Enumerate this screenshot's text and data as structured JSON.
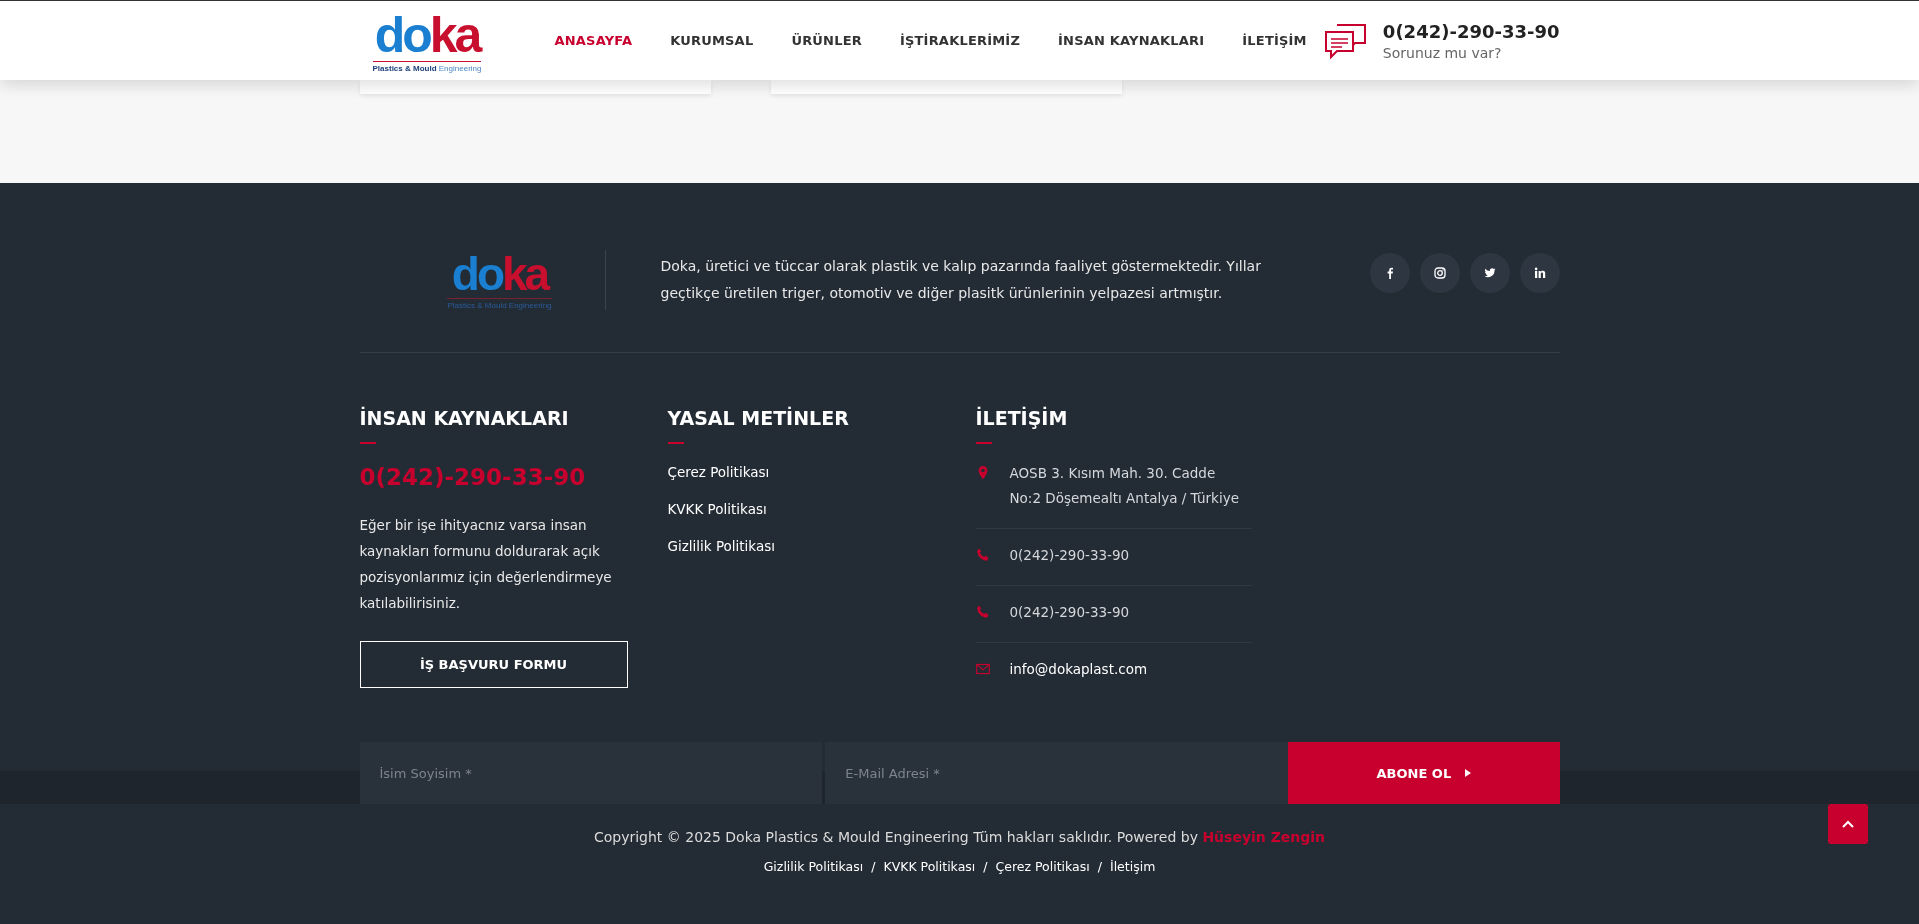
{
  "header": {
    "logo": {
      "wordmark": "doka",
      "tagline_strong": "Plastics & Mould",
      "tagline": "Engineering"
    },
    "nav": [
      {
        "label": "ANASAYFA",
        "selected": true
      },
      {
        "label": "KURUMSAL",
        "selected": false
      },
      {
        "label": "ÜRÜNLER",
        "selected": false
      },
      {
        "label": "İŞTİRAKLERİMİZ",
        "selected": false
      },
      {
        "label": "İNSAN KAYNAKLARI",
        "selected": false
      },
      {
        "label": "İLETİŞİM",
        "selected": false
      }
    ],
    "contact": {
      "phone": "0(242)-290-33-90",
      "subtitle": "Sorunuz mu var?"
    }
  },
  "footer": {
    "logo": {
      "wordmark": "doka",
      "tagline": "Plastics & Mould Engineering"
    },
    "description": "Doka, üretici ve tüccar olarak plastik ve kalıp pazarında faaliyet göstermektedir. Yıllar geçtikçe üretilen triger, otomotiv ve diğer plasitk ürünlerinin yelpazesi artmıştır.",
    "social": [
      {
        "kind": "facebook"
      },
      {
        "kind": "instagram"
      },
      {
        "kind": "twitter"
      },
      {
        "kind": "linkedin"
      }
    ],
    "hr": {
      "title": "İNSAN KAYNAKLARI",
      "phone": "0(242)-290-33-90",
      "text": "Eğer bir işe ihityacnız varsa insan kaynakları formunu doldurarak açık pozisyonlarımız için değerlendirmeye katılabilirisiniz.",
      "button": "İŞ BAŞVURU FORMU"
    },
    "legal": {
      "title": "YASAL METİNLER",
      "links": [
        "Çerez Politikası",
        "KVKK Politikası",
        "Gizlilik Politikası"
      ]
    },
    "contact": {
      "title": "İLETİŞİM",
      "items": [
        {
          "kind": "address",
          "lines": [
            "AOSB 3. Kısım Mah. 30. Cadde",
            "No:2 Döşemealtı Antalya / Türkiye"
          ]
        },
        {
          "kind": "phone",
          "lines": [
            "0(242)-290-33-90"
          ]
        },
        {
          "kind": "phone",
          "lines": [
            "0(242)-290-33-90"
          ]
        },
        {
          "kind": "email",
          "lines": [
            "info@dokaplast.com"
          ]
        }
      ]
    },
    "newsletter": {
      "name_placeholder": "İsim Soyisim *",
      "email_placeholder": "E-Mail Adresi *",
      "button": "ABONE OL"
    },
    "copyright": "Copyright © 2025 Doka Plastics & Mould Engineering Tüm hakları saklıdır. Powered by",
    "author": "Hüseyin Zengin",
    "bottom_links": [
      "Gizlilik Politikası",
      "KVKK Politikası",
      "Çerez Politikası",
      "İletişim"
    ],
    "separator": "/"
  }
}
